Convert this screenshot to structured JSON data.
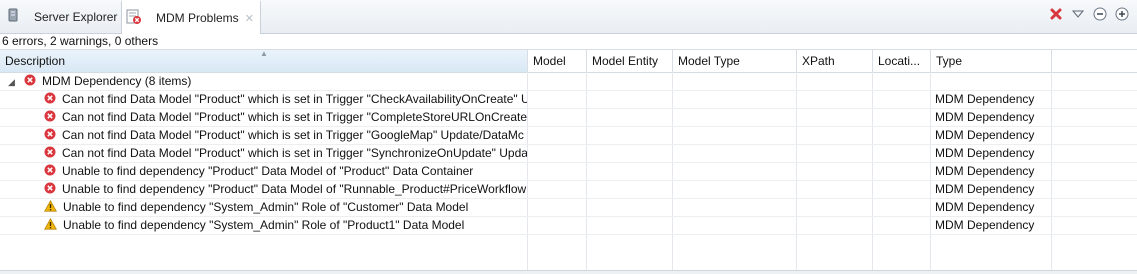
{
  "tabs": [
    {
      "label": "Server Explorer",
      "active": false
    },
    {
      "label": "MDM Problems",
      "active": true
    }
  ],
  "tab_close_glyph": "✕",
  "view_actions": [
    {
      "name": "delete-icon",
      "glyph": "✖"
    },
    {
      "name": "view-menu-icon",
      "glyph": "▽"
    },
    {
      "name": "minimize-icon",
      "glyph": "⊖"
    },
    {
      "name": "maximize-icon",
      "glyph": "⊕"
    }
  ],
  "status_text": "6 errors, 2 warnings, 0 others",
  "columns": [
    "Description",
    "Model",
    "Model Entity",
    "Model Type",
    "XPath",
    "Locati...",
    "Type"
  ],
  "group": {
    "label": "MDM Dependency (8 items)",
    "expanded": true,
    "twisty": "◢"
  },
  "rows": [
    {
      "severity": "error",
      "description": "Can not find Data Model \"Product\" which is set in Trigger \"CheckAvailabilityOnCreate\" U",
      "type": "MDM Dependency"
    },
    {
      "severity": "error",
      "description": "Can not find Data Model \"Product\" which is set in Trigger \"CompleteStoreURLOnCreate\"",
      "type": "MDM Dependency"
    },
    {
      "severity": "error",
      "description": "Can not find Data Model \"Product\" which is set in Trigger \"GoogleMap\" Update/DataMc",
      "type": "MDM Dependency"
    },
    {
      "severity": "error",
      "description": "Can not find Data Model \"Product\" which is set in Trigger \"SynchronizeOnUpdate\" Upda",
      "type": "MDM Dependency"
    },
    {
      "severity": "error",
      "description": "Unable to find dependency \"Product\" Data Model of \"Product\" Data Container",
      "type": "MDM Dependency"
    },
    {
      "severity": "error",
      "description": "Unable to find dependency \"Product\" Data Model of \"Runnable_Product#PriceWorkflow",
      "type": "MDM Dependency"
    },
    {
      "severity": "warning",
      "description": "Unable to find dependency \"System_Admin\" Role of \"Customer\" Data Model",
      "type": "MDM Dependency"
    },
    {
      "severity": "warning",
      "description": "Unable to find dependency \"System_Admin\" Role of \"Product1\" Data Model",
      "type": "MDM Dependency"
    }
  ],
  "colors": {
    "error": "#d9363e",
    "warning": "#e8a317",
    "accent": "#3a6ea5"
  }
}
